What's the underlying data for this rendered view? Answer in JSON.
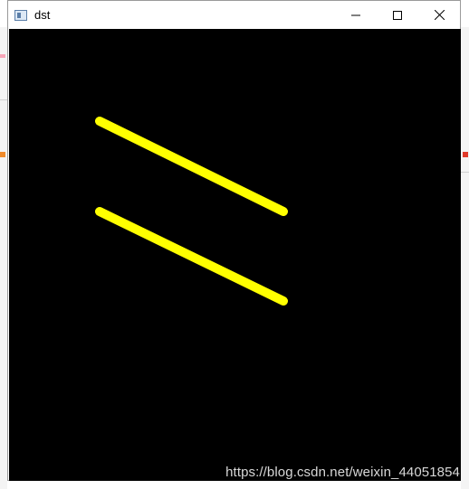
{
  "window": {
    "title": "dst",
    "icon": "opencv-window-icon",
    "controls": [
      "minimize-icon",
      "maximize-icon",
      "close-icon"
    ]
  },
  "canvas": {
    "background": "#000000",
    "line_color": "#ffff00"
  },
  "watermark": "https://blog.csdn.net/weixin_44051854"
}
